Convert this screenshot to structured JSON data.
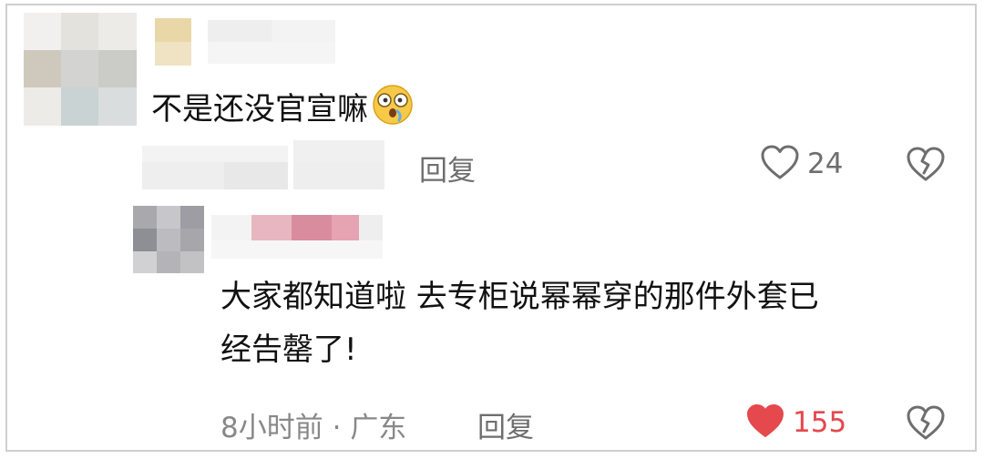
{
  "comments": [
    {
      "text": "不是还没官宣嘛",
      "emoji": "dizzy-face-emoji",
      "reply_label": "回复",
      "likes": "24",
      "liked": false
    },
    {
      "text_line1": "大家都知道啦 去专柜说幂幂穿的那件外套已",
      "text_line2": "经告罄了!",
      "time": "8小时前",
      "separator": "·",
      "location": "广东",
      "reply_label": "回复",
      "likes": "155",
      "liked": true
    }
  ],
  "colors": {
    "text": "#111111",
    "meta": "#888888",
    "liked": "#e5484d",
    "icon": "#6e6e6e"
  },
  "icons": [
    "heart-icon",
    "broken-heart-icon",
    "dizzy-face-emoji"
  ]
}
